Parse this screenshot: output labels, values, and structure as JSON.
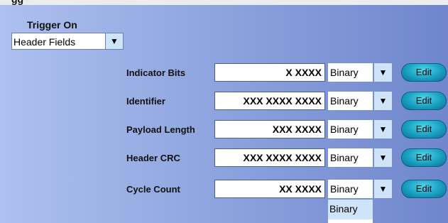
{
  "trigger": {
    "label": "Trigger On",
    "selected": "Header Fields",
    "arrow_glyph": "▼"
  },
  "fields": [
    {
      "label": "Indicator Bits",
      "value": "X XXXX",
      "format": "Binary",
      "edit_label": "Edit"
    },
    {
      "label": "Identifier",
      "value": "XXX XXXX XXXX",
      "format": "Binary",
      "edit_label": "Edit"
    },
    {
      "label": "Payload Length",
      "value": "XXX XXXX",
      "format": "Binary",
      "edit_label": "Edit"
    },
    {
      "label": "Header CRC",
      "value": "XXX XXXX XXXX",
      "format": "Binary",
      "edit_label": "Edit"
    },
    {
      "label": "Cycle Count",
      "value": "XX XXXX",
      "format": "Binary",
      "edit_label": "Edit"
    }
  ],
  "format_arrow_glyph": "▼",
  "dropdown": {
    "options": [
      "Binary"
    ]
  },
  "colors": {
    "edit_button": "#1aa0c2",
    "arrow_bg": "#cfe4f9",
    "panel_left": "#aec0ef",
    "panel_right": "#6f86cd"
  }
}
